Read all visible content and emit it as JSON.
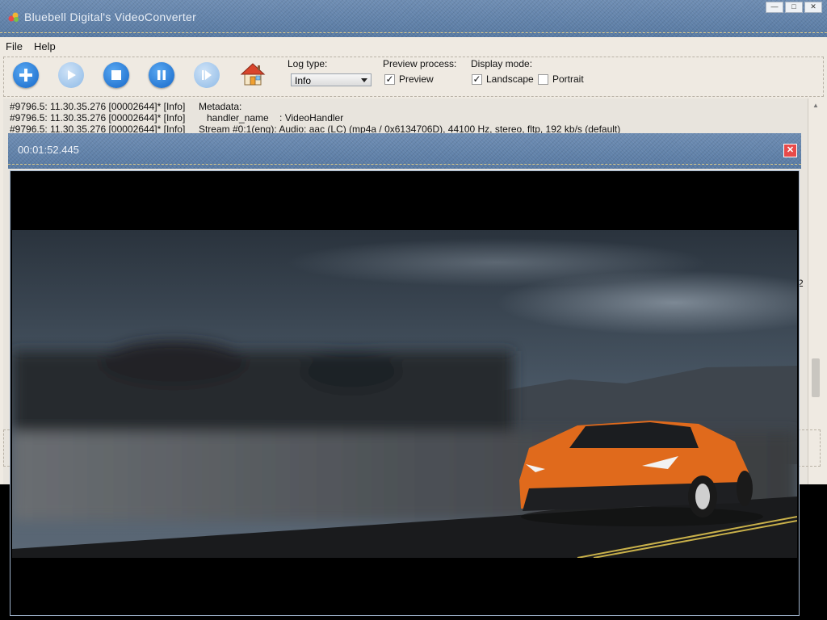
{
  "window": {
    "title": "Bluebell Digital's VideoConverter",
    "controls": [
      "—",
      "□",
      "✕"
    ]
  },
  "menu": {
    "items": [
      "File",
      "Help"
    ]
  },
  "toolbar": {
    "buttons": [
      {
        "name": "add",
        "icon": "plus-icon",
        "state": "enabled"
      },
      {
        "name": "play",
        "icon": "play-icon",
        "state": "disabled"
      },
      {
        "name": "stop",
        "icon": "stop-icon",
        "state": "enabled"
      },
      {
        "name": "pause",
        "icon": "pause-icon",
        "state": "enabled"
      },
      {
        "name": "step",
        "icon": "step-forward-icon",
        "state": "disabled"
      },
      {
        "name": "home",
        "icon": "home-icon",
        "state": "enabled"
      }
    ],
    "log_type": {
      "label": "Log type:",
      "value": "Info"
    },
    "preview_process": {
      "label": "Preview process:",
      "preview": {
        "label": "Preview",
        "checked": true
      }
    },
    "display_mode": {
      "label": "Display mode:",
      "landscape": {
        "label": "Landscape",
        "checked": true
      },
      "portrait": {
        "label": "Portrait",
        "checked": false
      }
    }
  },
  "log": {
    "lines": [
      "#9796.5: 11.30.35.276 [00002644]* [Info]     Metadata:",
      "#9796.5: 11.30.35.276 [00002644]* [Info]        handler_name    : VideoHandler",
      "#9796.5: 11.30.35.276 [00002644]* [Info]     Stream #0:1(eng): Audio: aac (LC) (mp4a / 0x6134706D), 44100 Hz, stereo, fltp, 192 kb/s (default)"
    ],
    "partial_right": "2"
  },
  "preview": {
    "timestamp": "00:01:52.445",
    "close": "✕"
  },
  "colors": {
    "denim": "#5f7ea6",
    "accent_blue": "#1466c8",
    "car_orange": "#e06a1c"
  }
}
